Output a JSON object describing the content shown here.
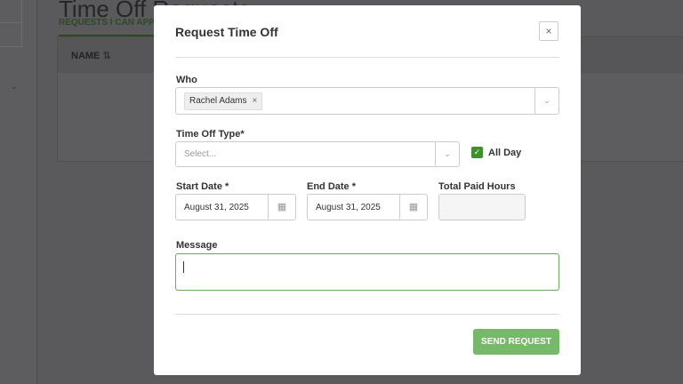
{
  "background": {
    "page_title": "Time Off Requests",
    "tab": "REQUESTS I CAN APPROVE",
    "column_name": "NAME",
    "sort_icon": "sort-icon"
  },
  "modal": {
    "title": "Request Time Off",
    "close": "×",
    "who": {
      "label": "Who",
      "chips": [
        {
          "name": "Rachel Adams",
          "remove": "×"
        }
      ]
    },
    "type": {
      "label": "Time Off Type*",
      "placeholder": "Select..."
    },
    "all_day": {
      "label": "All Day",
      "checked": true
    },
    "start": {
      "label": "Start Date *",
      "value": "August 31, 2025"
    },
    "end": {
      "label": "End Date *",
      "value": "August 31, 2025"
    },
    "hours": {
      "label": "Total Paid Hours",
      "value": ""
    },
    "message": {
      "label": "Message",
      "value": ""
    },
    "send": "SEND REQUEST"
  },
  "colors": {
    "accent": "#3f8f2a",
    "button": "#76b96b"
  }
}
